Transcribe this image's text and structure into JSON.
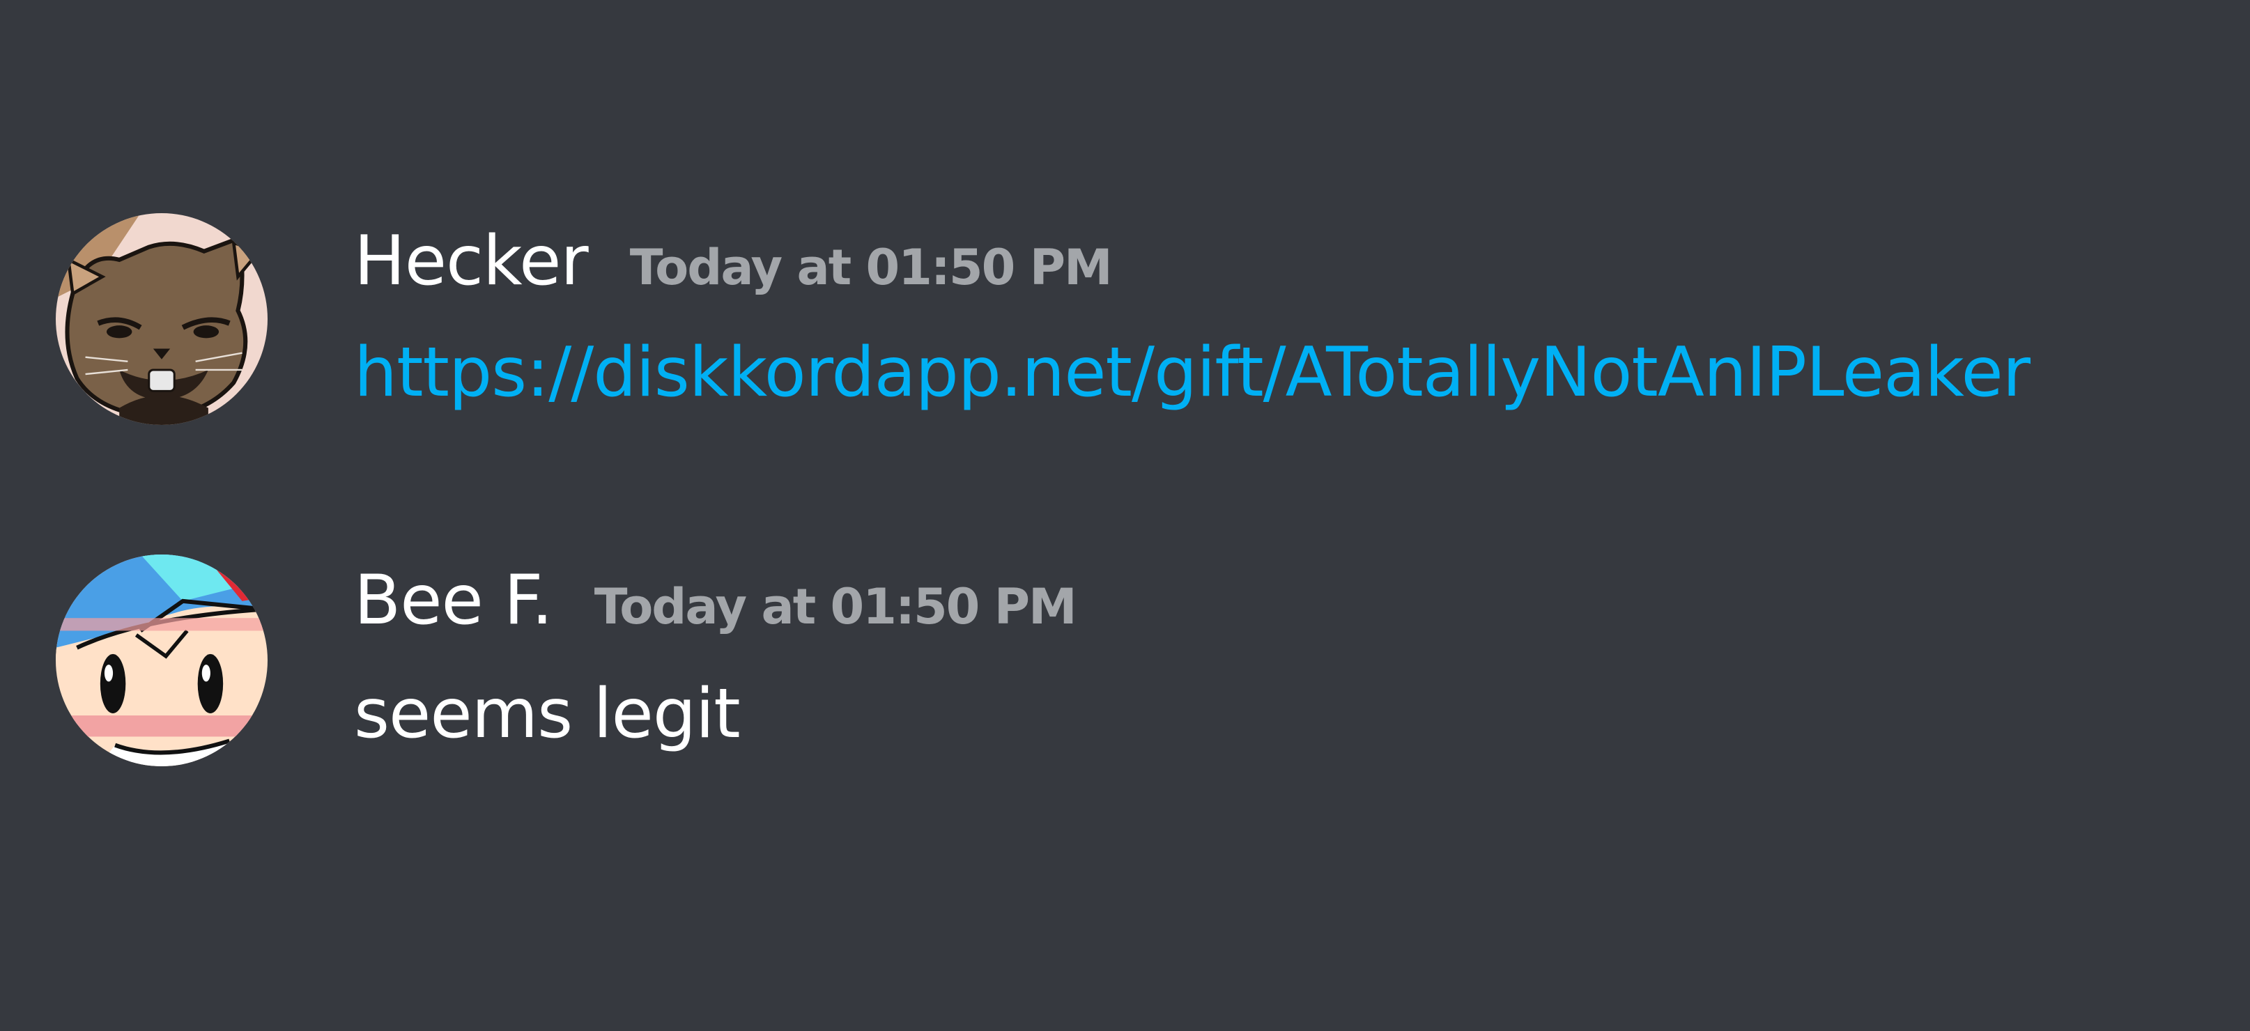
{
  "messages": [
    {
      "username": "Hecker",
      "timestamp": "Today at 01:50 PM",
      "content": "https://diskkordapp.net/gift/ATotallyNotAnIPLeaker",
      "content_is_link": true,
      "avatar_icon": "cat-avatar-icon"
    },
    {
      "username": "Bee F.",
      "timestamp": "Today at 01:50 PM",
      "content": "seems legit",
      "content_is_link": false,
      "avatar_icon": "cartoon-boy-avatar-icon"
    }
  ],
  "colors": {
    "background": "#36393f",
    "username": "#ffffff",
    "timestamp": "#a3a6aa",
    "link": "#00b0f4",
    "text": "#ffffff"
  }
}
